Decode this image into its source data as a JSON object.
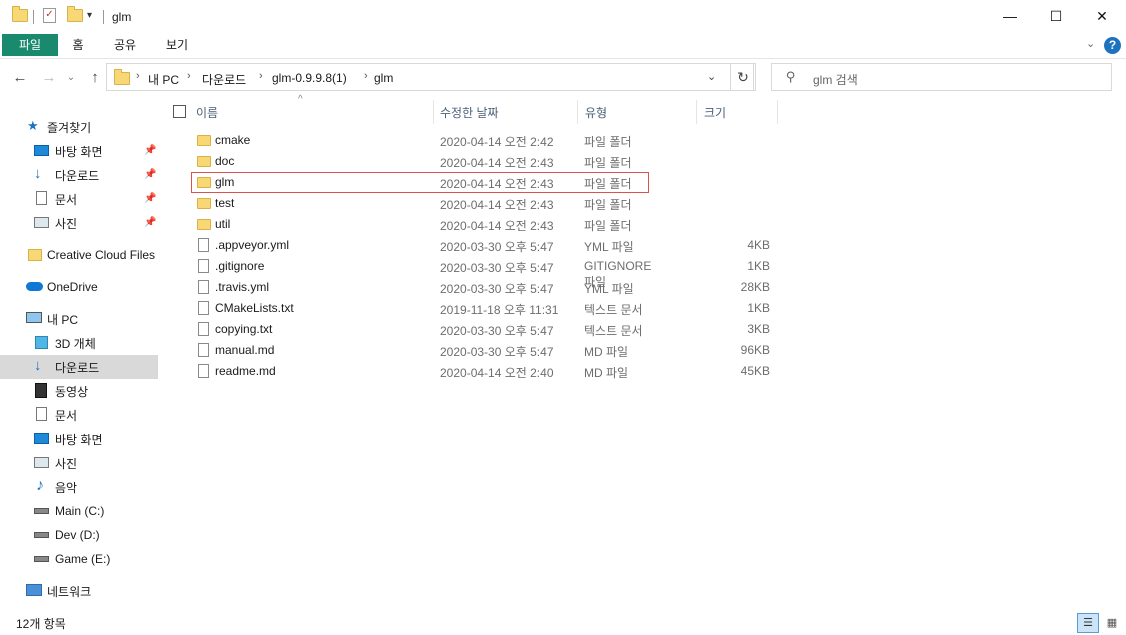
{
  "window": {
    "title": "glm",
    "minimize": "—",
    "maximize": "☐",
    "close": "✕"
  },
  "ribbon": {
    "tabs": [
      "파일",
      "홈",
      "공유",
      "보기"
    ]
  },
  "address": {
    "crumbs": [
      "내 PC",
      "다운로드",
      "glm-0.9.9.8(1)",
      "glm"
    ],
    "separator": "›"
  },
  "search": {
    "placeholder": "glm 검색"
  },
  "navpane": {
    "items": [
      {
        "label": "즐겨찾기",
        "icon": "star-icon"
      },
      {
        "label": "바탕 화면",
        "icon": "desktop-icon"
      },
      {
        "label": "다운로드",
        "icon": "download-icon"
      },
      {
        "label": "문서",
        "icon": "document-icon"
      },
      {
        "label": "사진",
        "icon": "pictures-icon"
      },
      {
        "label": "Creative Cloud Files",
        "icon": "creative-cloud-icon"
      },
      {
        "label": "OneDrive",
        "icon": "onedrive-icon"
      },
      {
        "label": "내 PC",
        "icon": "pc-icon"
      },
      {
        "label": "3D 개체",
        "icon": "3d-objects-icon"
      },
      {
        "label": "다운로드",
        "icon": "download-icon"
      },
      {
        "label": "동영상",
        "icon": "video-icon"
      },
      {
        "label": "문서",
        "icon": "document-icon"
      },
      {
        "label": "바탕 화면",
        "icon": "desktop-icon"
      },
      {
        "label": "사진",
        "icon": "pictures-icon"
      },
      {
        "label": "음악",
        "icon": "music-icon"
      },
      {
        "label": "Main (C:)",
        "icon": "drive-icon"
      },
      {
        "label": "Dev (D:)",
        "icon": "drive-icon"
      },
      {
        "label": "Game (E:)",
        "icon": "drive-icon"
      },
      {
        "label": "네트워크",
        "icon": "network-icon"
      }
    ]
  },
  "columns": {
    "name": "이름",
    "modified": "수정한 날짜",
    "type": "유형",
    "size": "크기"
  },
  "files": [
    {
      "name": "cmake",
      "modified": "2020-04-14 오전 2:42",
      "type": "파일 폴더",
      "size": "",
      "kind": "folder"
    },
    {
      "name": "doc",
      "modified": "2020-04-14 오전 2:43",
      "type": "파일 폴더",
      "size": "",
      "kind": "folder"
    },
    {
      "name": "glm",
      "modified": "2020-04-14 오전 2:43",
      "type": "파일 폴더",
      "size": "",
      "kind": "folder"
    },
    {
      "name": "test",
      "modified": "2020-04-14 오전 2:43",
      "type": "파일 폴더",
      "size": "",
      "kind": "folder"
    },
    {
      "name": "util",
      "modified": "2020-04-14 오전 2:43",
      "type": "파일 폴더",
      "size": "",
      "kind": "folder"
    },
    {
      "name": ".appveyor.yml",
      "modified": "2020-03-30 오후 5:47",
      "type": "YML 파일",
      "size": "4KB",
      "kind": "file"
    },
    {
      "name": ".gitignore",
      "modified": "2020-03-30 오후 5:47",
      "type": "GITIGNORE 파일",
      "size": "1KB",
      "kind": "file"
    },
    {
      "name": ".travis.yml",
      "modified": "2020-03-30 오후 5:47",
      "type": "YML 파일",
      "size": "28KB",
      "kind": "file"
    },
    {
      "name": "CMakeLists.txt",
      "modified": "2019-11-18 오후 11:31",
      "type": "텍스트 문서",
      "size": "1KB",
      "kind": "file"
    },
    {
      "name": "copying.txt",
      "modified": "2020-03-30 오후 5:47",
      "type": "텍스트 문서",
      "size": "3KB",
      "kind": "file"
    },
    {
      "name": "manual.md",
      "modified": "2020-03-30 오후 5:47",
      "type": "MD 파일",
      "size": "96KB",
      "kind": "file"
    },
    {
      "name": "readme.md",
      "modified": "2020-04-14 오전 2:40",
      "type": "MD 파일",
      "size": "45KB",
      "kind": "file"
    }
  ],
  "status": {
    "count": "12개 항목"
  },
  "colors": {
    "file_tab": "#1a8a6e",
    "highlight_box": "#d9534f",
    "nav_selected": "#d9d9d9",
    "folder": "#f8d775",
    "help": "#1e73be"
  }
}
